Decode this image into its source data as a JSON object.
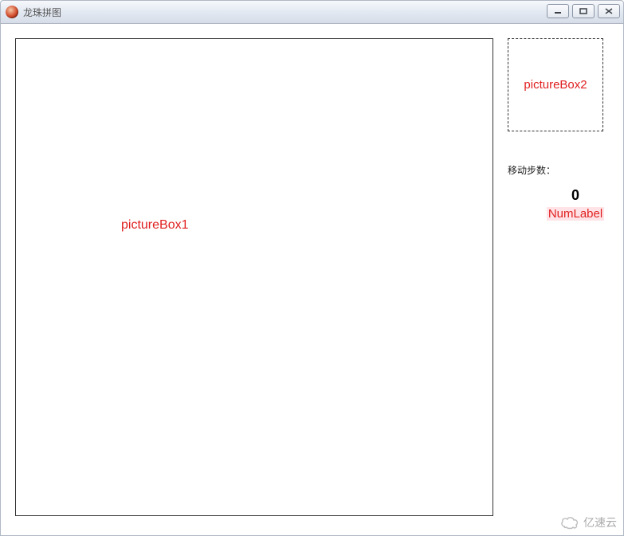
{
  "window": {
    "title": "龙珠拼图"
  },
  "main": {
    "picturebox1_label": "pictureBox1",
    "picturebox2_label": "pictureBox2",
    "moves_label": "移动步数：",
    "moves_value": "0",
    "num_label": "NumLabel"
  },
  "watermark": {
    "text": "亿速云"
  }
}
